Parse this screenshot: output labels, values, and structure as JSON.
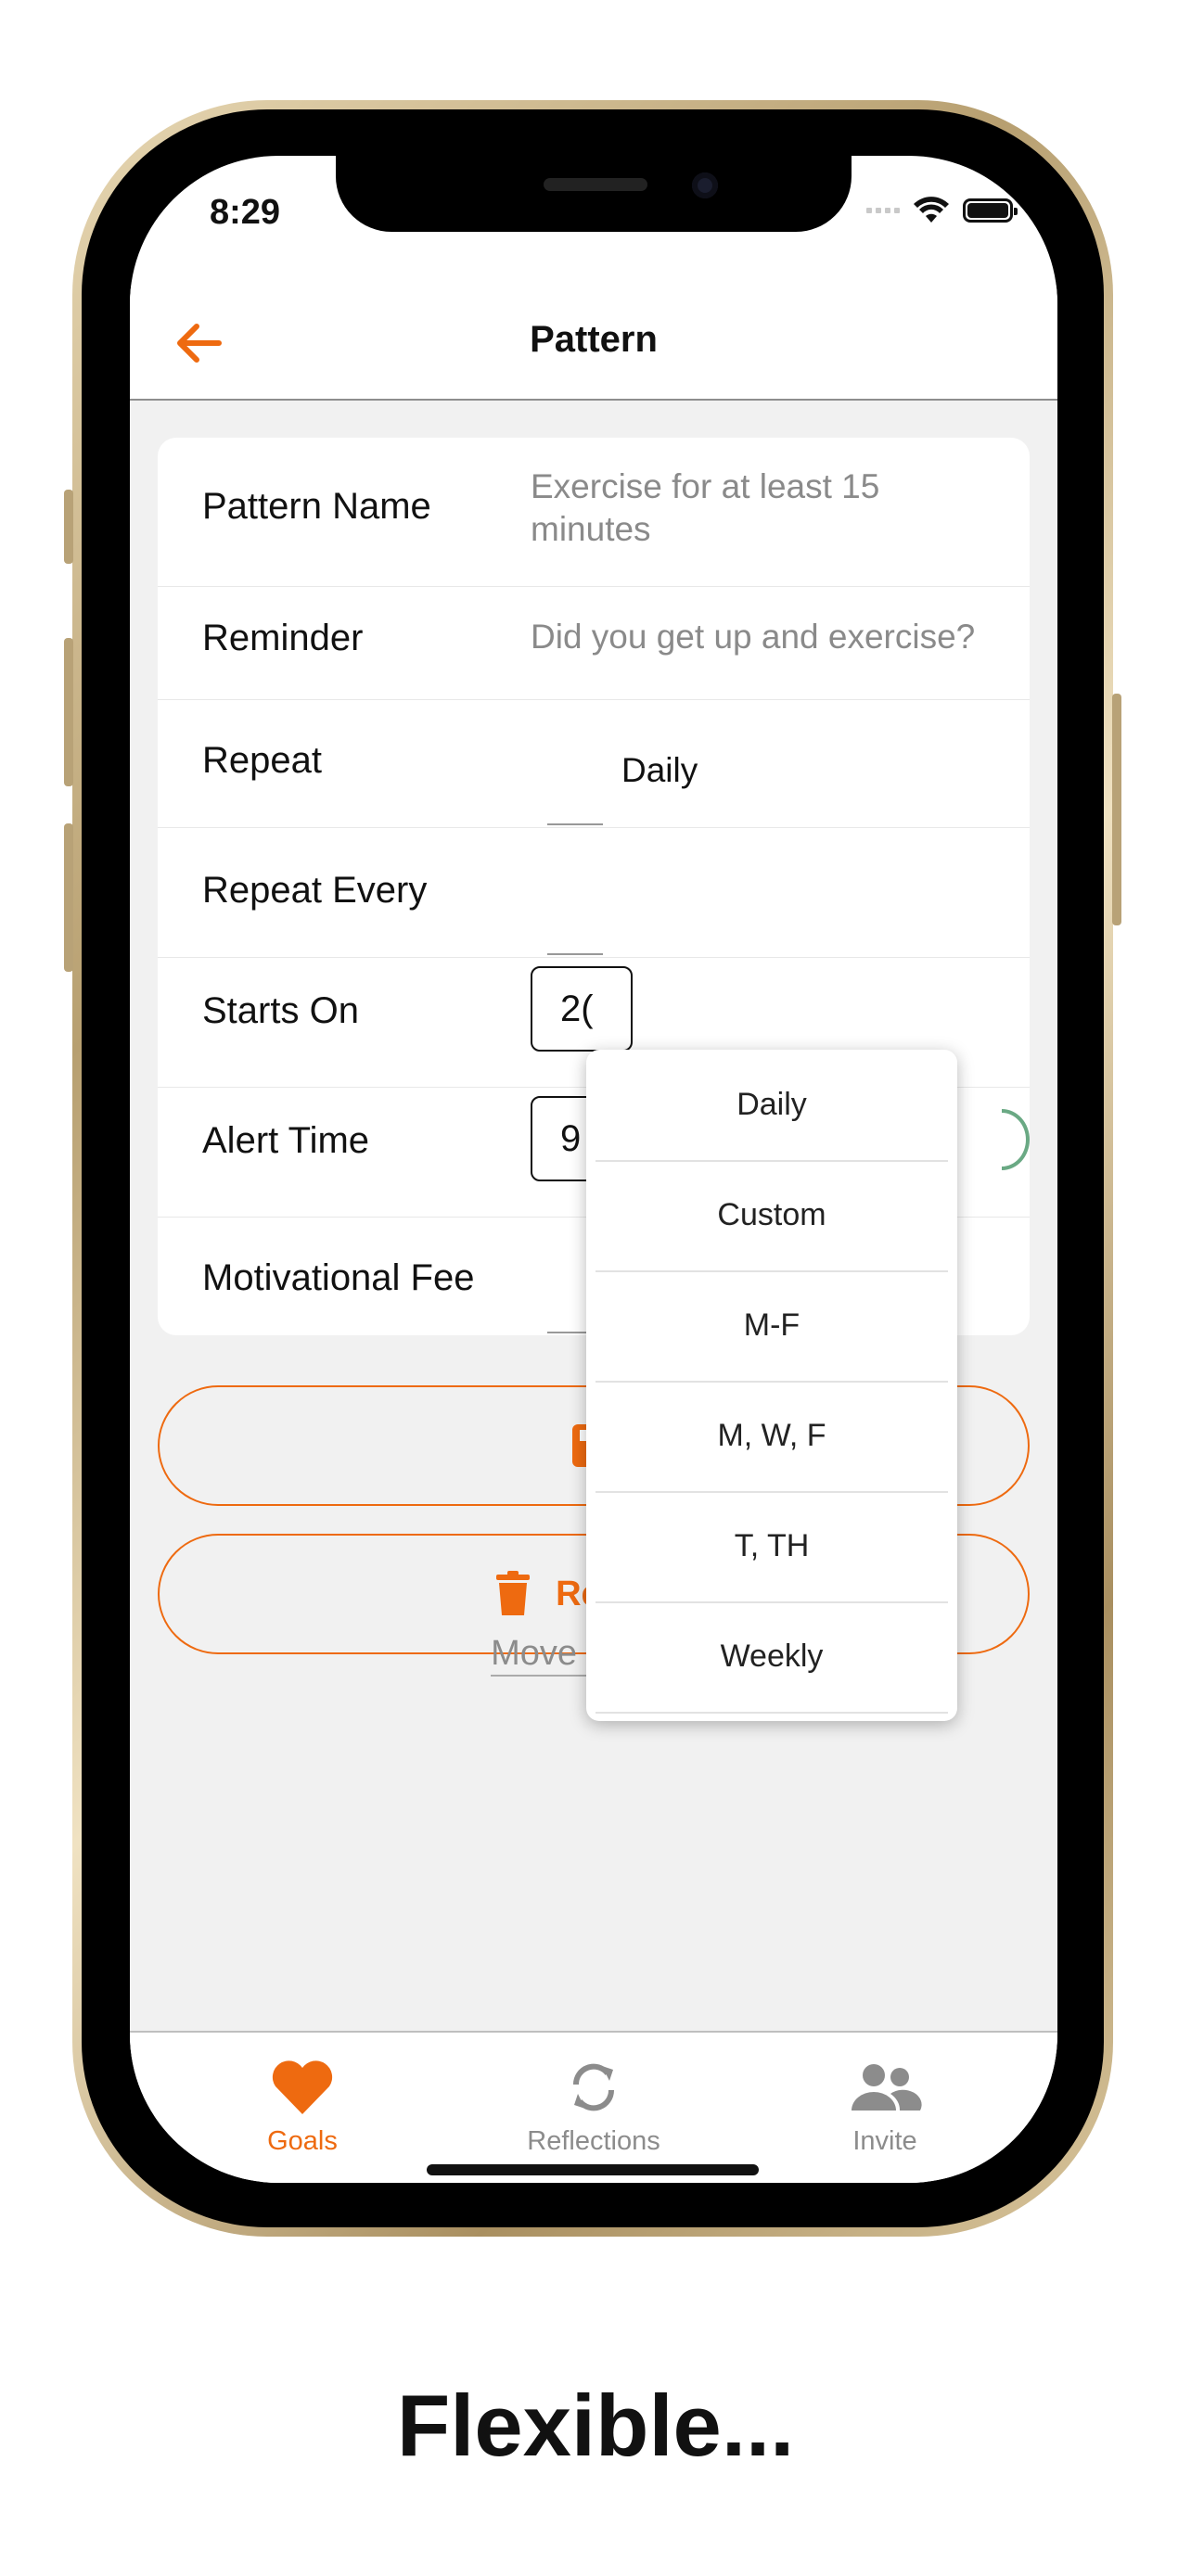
{
  "status_bar": {
    "time": "8:29"
  },
  "nav": {
    "title": "Pattern"
  },
  "form": {
    "pattern_name": {
      "label": "Pattern Name",
      "value": "Exercise for at least 15 minutes"
    },
    "reminder": {
      "label": "Reminder",
      "value": "Did you get up and exercise?"
    },
    "repeat": {
      "label": "Repeat",
      "value": "Daily"
    },
    "repeat_every": {
      "label": "Repeat Every"
    },
    "starts_on": {
      "label": "Starts On",
      "value_partial": "2("
    },
    "alert_time": {
      "label": "Alert Time",
      "value_partial": "9"
    },
    "motivational_fee": {
      "label": "Motivational Fee"
    }
  },
  "dropdown": {
    "options": [
      "Daily",
      "Custom",
      "M-F",
      "M, W, F",
      "T, TH",
      "Weekly"
    ]
  },
  "buttons": {
    "remove_label": "Remove",
    "move_link": "Move pattern"
  },
  "tabs": [
    {
      "label": "Goals",
      "icon": "heart-icon",
      "active": true
    },
    {
      "label": "Reflections",
      "icon": "sync-icon",
      "active": false
    },
    {
      "label": "Invite",
      "icon": "users-icon",
      "active": false
    }
  ],
  "caption": "Flexible...",
  "colors": {
    "accent": "#ee6a10",
    "inactive": "#8c8c8c",
    "background": "#f1f1f1"
  }
}
